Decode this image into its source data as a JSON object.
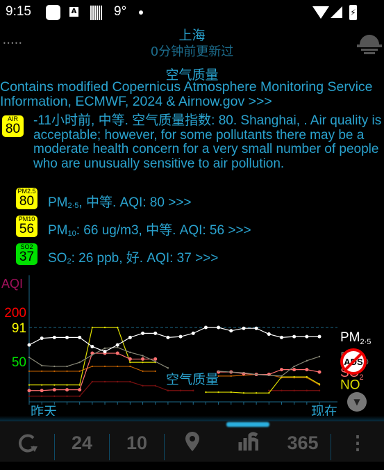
{
  "status": {
    "time": "9:15",
    "temp": "9°",
    "a_icon": "A"
  },
  "header": {
    "city": "上海",
    "updated": "0分钟前更新过",
    "page_dots": "•••••"
  },
  "air": {
    "title": "空气质量",
    "attribution": "Contains modified Copernicus Atmosphere Monitoring Service Information, ECMWF, 2024 & Airnow.gov >>>",
    "overall": {
      "badge_label": "AIR",
      "value": "80",
      "color": "#ffff00",
      "text": "-11小时前, 中等. 空气质量指数: 80. Shanghai,   . Air quality is acceptable; however, for some pollutants there may be a moderate health concern for a very small number of people who are unusually sensitive to air pollution."
    },
    "pollutants": [
      {
        "badge_label": "PM2.5",
        "value": "80",
        "color": "#ffff00",
        "name": "PM",
        "sub": "2·5",
        "rest": ", 中等. AQI: 80 >>>"
      },
      {
        "badge_label": "PM10",
        "value": "56",
        "color": "#ffff00",
        "name": "PM",
        "sub": "10",
        "rest": ": 66 ug/m3, 中等. AQI: 56 >>>"
      },
      {
        "badge_label": "SO2",
        "value": "37",
        "color": "#00e000",
        "name": "SO",
        "sub": "2",
        "rest": ": 26 ppb, 好. AQI: 37 >>>"
      }
    ]
  },
  "chart_data": {
    "type": "line",
    "ylabel": "AQI",
    "y_ticks": [
      {
        "label": "200",
        "value": 200,
        "color": "#ff0000"
      },
      {
        "label": "91",
        "value": 91,
        "color": "#ffff00"
      },
      {
        "label": "50",
        "value": 50,
        "color": "#00e000"
      }
    ],
    "reference_line": 91,
    "x_start_label": "昨天",
    "x_end_label": "现在",
    "watermark": "空气质量",
    "hours": 24,
    "series": [
      {
        "name": "PM",
        "sub": "2·5",
        "color": "#ffffff",
        "dots": true,
        "values": [
          70,
          78,
          79,
          79,
          79,
          68,
          62,
          70,
          79,
          84,
          84,
          79,
          80,
          84,
          91,
          91,
          87,
          90,
          90,
          83,
          79,
          80,
          80,
          80
        ]
      },
      {
        "name": "PM",
        "sub": "10",
        "color": "#888877",
        "dots": false,
        "values": [
          55,
          45,
          44,
          44,
          49,
          58,
          66,
          67,
          61,
          57,
          50,
          42,
          null,
          null,
          null,
          38,
          37,
          36,
          34,
          33,
          32,
          44,
          51,
          56
        ]
      },
      {
        "name": "SO",
        "sub": "2",
        "color": "#ff7070",
        "dots": true,
        "values": [
          14,
          14,
          15,
          15,
          15,
          60,
          60,
          60,
          53,
          53,
          53,
          null,
          null,
          null,
          null,
          37,
          37,
          35,
          34,
          34,
          40,
          40,
          40,
          37
        ]
      },
      {
        "name": "NO",
        "sub": "",
        "color": "#dddd00",
        "dots": false,
        "values": [
          21,
          21,
          21,
          21,
          21,
          91,
          91,
          91,
          49,
          49,
          49,
          null,
          null,
          null,
          12,
          12,
          12,
          11,
          11,
          11,
          31,
          31,
          31,
          22
        ]
      },
      {
        "color": "#c06000",
        "dots": false,
        "values": [
          38,
          38,
          38,
          38,
          38,
          44,
          44,
          44,
          44,
          38,
          38,
          null,
          null,
          null,
          null,
          32,
          32,
          33,
          34,
          34,
          30,
          30,
          30,
          21
        ]
      },
      {
        "color": "#7a1010",
        "dots": false,
        "values": [
          7,
          7,
          7,
          7,
          7,
          25,
          25,
          25,
          25,
          20,
          20,
          14,
          14,
          14,
          null,
          null,
          null,
          null,
          null,
          14,
          14,
          14,
          14,
          14
        ]
      }
    ]
  },
  "ads_label": "ADS",
  "nav": {
    "refresh": "refresh",
    "h24": "24",
    "d10": "10",
    "location": "location",
    "chart": "chart",
    "d365": "365",
    "more": "more"
  }
}
